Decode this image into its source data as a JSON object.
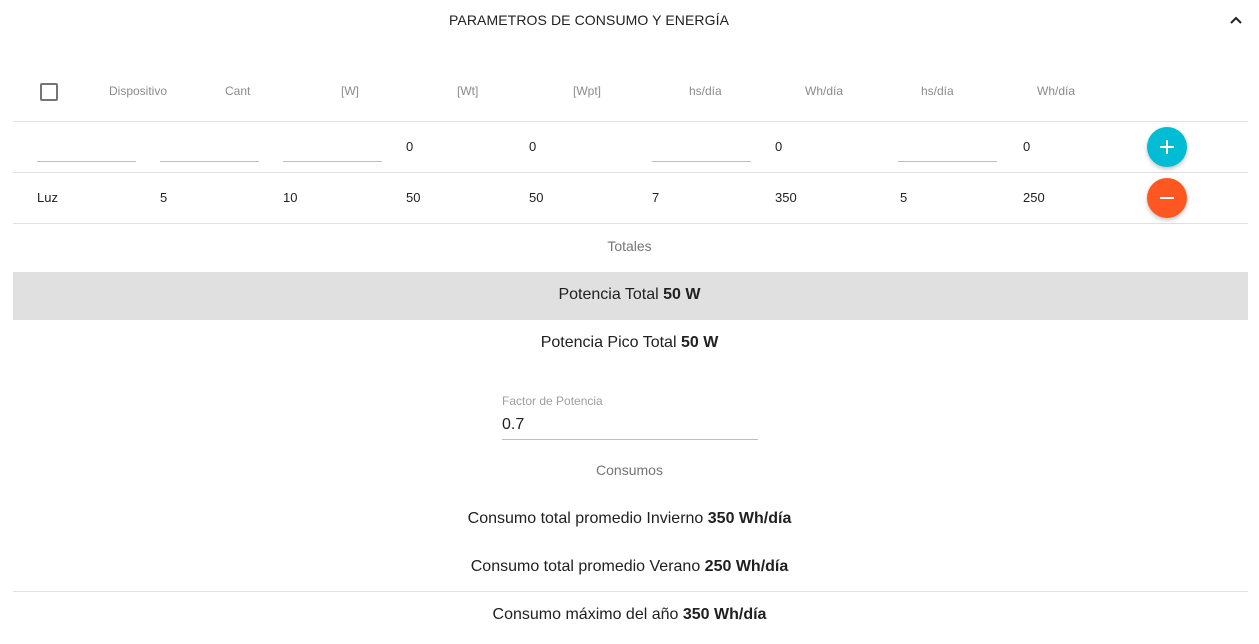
{
  "panel": {
    "title": "PARAMETROS DE CONSUMO Y ENERGÍA",
    "collapse_icon": "chevron-up-icon"
  },
  "table": {
    "headers": [
      "Dispositivo",
      "Cant",
      "[W]",
      "[Wt]",
      "[Wpt]",
      "hs/día",
      "Wh/día",
      "hs/día",
      "Wh/día"
    ],
    "input_row": {
      "dispositivo": "",
      "cant": "",
      "w": "",
      "wt": "0",
      "wpt": "0",
      "hs_invierno": "",
      "wh_invierno": "0",
      "hs_verano": "",
      "wh_verano": "0",
      "add_icon": "plus-icon",
      "add_color": "#00BCD4"
    },
    "rows": [
      {
        "dispositivo": "Luz",
        "cant": "5",
        "w": "10",
        "wt": "50",
        "wpt": "50",
        "hs_invierno": "7",
        "wh_invierno": "350",
        "hs_verano": "5",
        "wh_verano": "250",
        "remove_icon": "minus-icon",
        "remove_color": "#FF5722"
      }
    ]
  },
  "totales": {
    "label": "Totales",
    "potencia_total_label": "Potencia Total",
    "potencia_total_value": "50 W",
    "potencia_pico_label": "Potencia Pico Total",
    "potencia_pico_value": "50 W"
  },
  "factor_potencia": {
    "label": "Factor de Potencia",
    "value": "0.7"
  },
  "consumos": {
    "label": "Consumos",
    "invierno_label": "Consumo total promedio Invierno",
    "invierno_value": "350 Wh/día",
    "verano_label": "Consumo total promedio Verano",
    "verano_value": "250 Wh/día",
    "maximo_label": "Consumo máximo del año",
    "maximo_value": "350 Wh/día"
  }
}
